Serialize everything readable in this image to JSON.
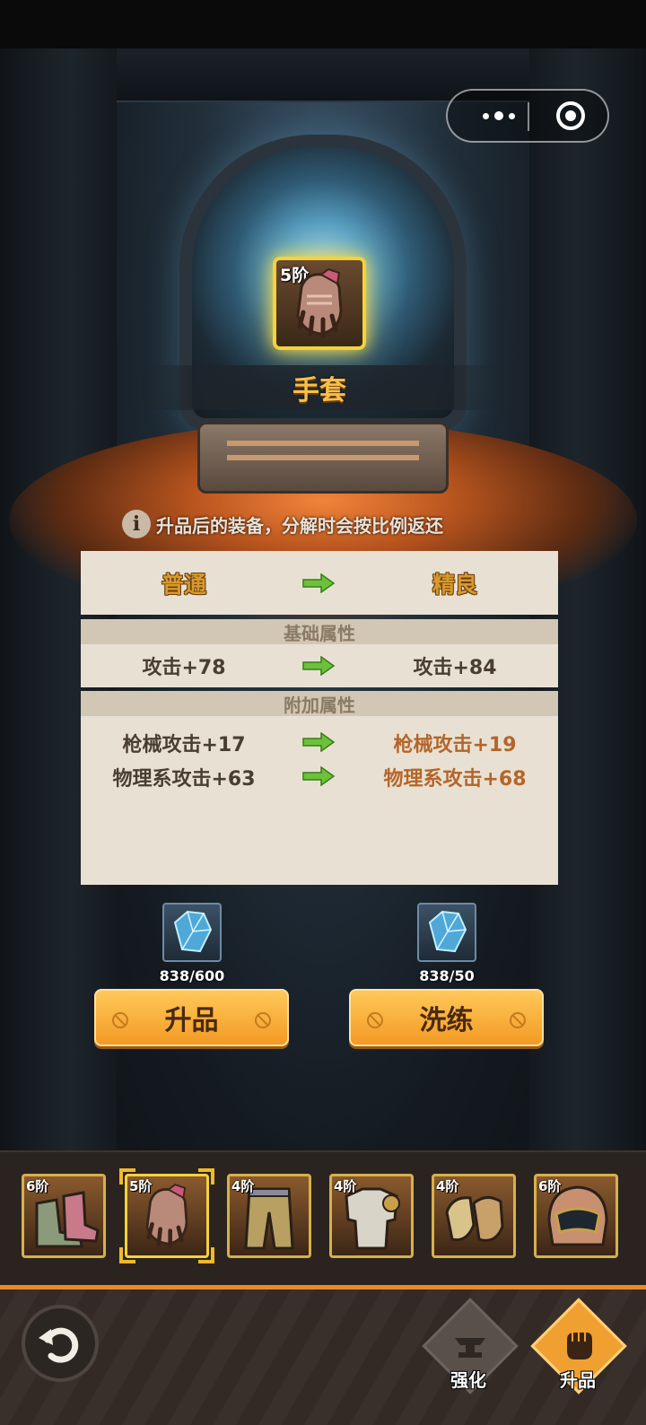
{
  "item": {
    "tier_badge": "5阶",
    "name": "手套",
    "icon": "glove-icon"
  },
  "notice": "升品后的装备，分解时会按比例返还",
  "compare": {
    "from_rarity": "普通",
    "to_rarity": "精良",
    "base_header": "基础属性",
    "base_stats": [
      {
        "from": "攻击+78",
        "to": "攻击+84"
      }
    ],
    "extra_header": "附加属性",
    "extra_stats": [
      {
        "from": "枪械攻击+17",
        "to": "枪械攻击+19"
      },
      {
        "from": "物理系攻击+63",
        "to": "物理系攻击+68"
      }
    ]
  },
  "materials": [
    {
      "icon": "crystal-icon",
      "count": "838/600",
      "button": "升品"
    },
    {
      "icon": "crystal-icon",
      "count": "838/50",
      "button": "洗练"
    }
  ],
  "equipment_slots": [
    {
      "tier": "6阶",
      "icon": "boots-icon",
      "selected": false
    },
    {
      "tier": "5阶",
      "icon": "glove-icon",
      "selected": true
    },
    {
      "tier": "4阶",
      "icon": "pants-icon",
      "selected": false
    },
    {
      "tier": "4阶",
      "icon": "armor-icon",
      "selected": false
    },
    {
      "tier": "4阶",
      "icon": "gauntlet-icon",
      "selected": false
    },
    {
      "tier": "6阶",
      "icon": "helmet-icon",
      "selected": false
    }
  ],
  "bottom_nav": [
    {
      "label": "强化",
      "icon": "anvil-icon",
      "active": false
    },
    {
      "label": "升品",
      "icon": "fist-icon",
      "active": true
    }
  ],
  "colors": {
    "accent": "#f39a24",
    "highlight": "#f3d23c",
    "panel": "#e8e1d3",
    "stat_up": "#b5652a"
  }
}
